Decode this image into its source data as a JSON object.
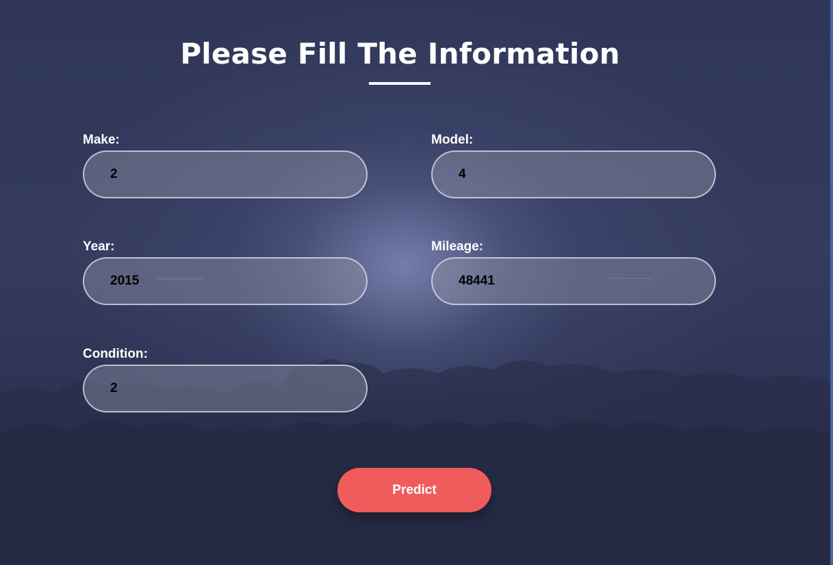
{
  "form": {
    "title": "Please Fill The Information",
    "fields": {
      "make": {
        "label": "Make:",
        "value": "2"
      },
      "model": {
        "label": "Model:",
        "value": "4"
      },
      "year": {
        "label": "Year:",
        "value": "2015"
      },
      "mileage": {
        "label": "Mileage:",
        "value": "48441"
      },
      "condition": {
        "label": "Condition:",
        "value": "2"
      }
    },
    "submit_label": "Predict"
  },
  "colors": {
    "background": "#2f3657",
    "input_border": "#e1e1eb",
    "button": "#f05c5c",
    "button_text": "#ffffff",
    "text": "#ffffff",
    "accent_edge": "#4a63a8"
  }
}
